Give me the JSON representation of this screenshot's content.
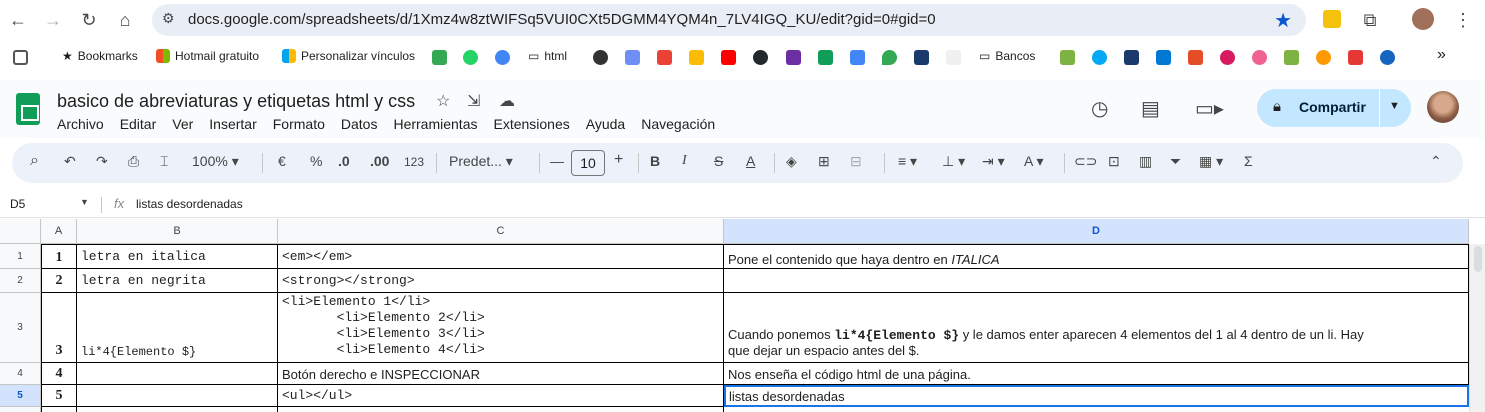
{
  "browser": {
    "url": "docs.google.com/spreadsheets/d/1Xmz4w8ztWIFSq5VUI0CXt5DGMM4YQM4n_7LV4IGQ_KU/edit?gid=0#gid=0"
  },
  "bookmarks": {
    "items": [
      "Bookmarks",
      "Hotmail gratuito",
      "Personalizar vínculos",
      "html",
      "Bancos"
    ],
    "more": "»"
  },
  "sheet": {
    "title": "basico de abreviaturas y etiquetas html y css",
    "menu": [
      "Archivo",
      "Editar",
      "Ver",
      "Insertar",
      "Formato",
      "Datos",
      "Herramientas",
      "Extensiones",
      "Ayuda",
      "Navegación"
    ],
    "share_label": "Compartir"
  },
  "toolbar": {
    "zoom": "100%",
    "currency": "€",
    "percent": "%",
    "dec_less": ".0",
    "dec_more": ".00",
    "number_format": "123",
    "font": "Predet...",
    "font_size": "10",
    "bold": "B",
    "italic": "I",
    "strike": "S",
    "text_color": "A",
    "sum": "Σ"
  },
  "formula_bar": {
    "cell_ref": "D5",
    "fx": "fx",
    "value": "listas desordenadas"
  },
  "columns": [
    "A",
    "B",
    "C",
    "D"
  ],
  "rows": [
    {
      "num": "1",
      "a": "1",
      "b": "letra en italica",
      "c": "<em></em>",
      "d_pre": "Pone el contenido que haya dentro en ",
      "d_em": "ITALICA"
    },
    {
      "num": "2",
      "a": "2",
      "b": "letra en negrita",
      "c": "<strong></strong>",
      "d": ""
    },
    {
      "num": "3",
      "a": "3",
      "b": "li*4{Elemento $}",
      "c_lines": [
        "<li>Elemento 1</li>",
        "       <li>Elemento 2</li>",
        "       <li>Elemento 3</li>",
        "       <li>Elemento 4</li>"
      ],
      "d_line1_pre": "Cuando ponemos ",
      "d_line1_bold": "li*4{Elemento $}",
      "d_line1_post": " y le damos enter aparecen 4 elementos del 1 al 4 dentro de un li. Hay",
      "d_line2": "que dejar un espacio antes del $."
    },
    {
      "num": "4",
      "a": "4",
      "b": "",
      "c": "Botón derecho e INSPECCIONAR",
      "d": "Nos enseña el código html de una página."
    },
    {
      "num": "5",
      "a": "5",
      "b": "",
      "c": "<ul></ul>",
      "d": "listas desordenadas"
    }
  ]
}
